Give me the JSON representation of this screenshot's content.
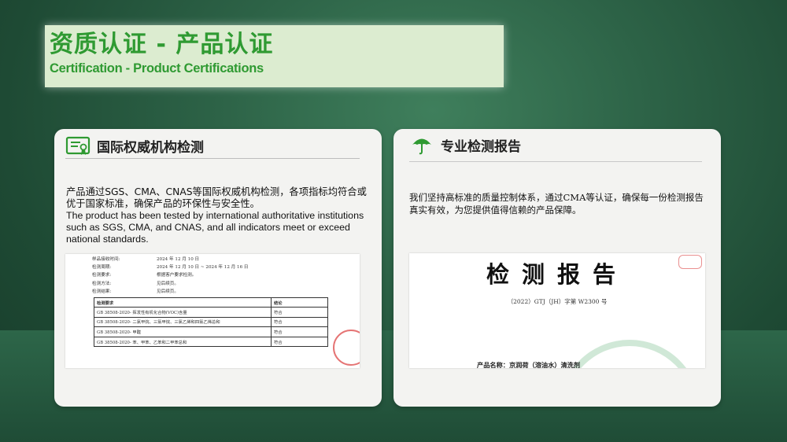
{
  "header": {
    "title_cn": "资质认证 - 产品认证",
    "title_en": "Certification - Product Certifications"
  },
  "left_card": {
    "icon": "certificate-icon",
    "heading": "国际权威机构检测",
    "desc_cn": "产品通过SGS、CMA、CNAS等国际权威机构检测，各项指标均符合或优于国家标准，确保产品的环保性与安全性。",
    "desc_en": "The product has been tested by international authoritative institutions such as SGS, CMA, and CNAS, and all indicators meet or exceed national standards.",
    "doc": {
      "meta": [
        {
          "k": "样品接收时间:",
          "v": "2024 年 12 月 10 日"
        },
        {
          "k": "检测周期:",
          "v": "2024 年 12 月 10 日 ~ 2024 年 12 月 16 日"
        },
        {
          "k": "检测要求:",
          "v": "根据客户要求检测。"
        },
        {
          "k": "检测方法:",
          "v": "见后续页。"
        },
        {
          "k": "检测结果:",
          "v": "见后续页。"
        }
      ],
      "table_header": [
        "检测要求",
        "结论"
      ],
      "rows": [
        [
          "GB 38508-2020- 挥发性有机化合物(VOC)含量",
          "符合"
        ],
        [
          "GB 38508-2020- 二氯甲烷、三氯甲烷、三氯乙烯和四氯乙烯总和",
          "符合"
        ],
        [
          "GB 38508-2020- 甲醛",
          "符合"
        ],
        [
          "GB 38508-2020- 苯、甲苯、乙苯和二甲苯总和",
          "符合"
        ]
      ]
    }
  },
  "right_card": {
    "icon": "umbrella-icon",
    "heading": "专业检测报告",
    "desc": "我们坚持高标准的质量控制体系，通过CMA等认证，确保每一份检测报告真实有效，为您提供值得信赖的产品保障。",
    "report": {
      "title": "检测报告",
      "number": "（2022）GTJ（JH）字第 W2300 号",
      "product": "产品名称：京润荷（溶油水）清洗剂"
    }
  },
  "colors": {
    "accent_green": "#2f9a32",
    "title_bg": "#dcecd0",
    "card_bg": "#f3f3f1"
  }
}
